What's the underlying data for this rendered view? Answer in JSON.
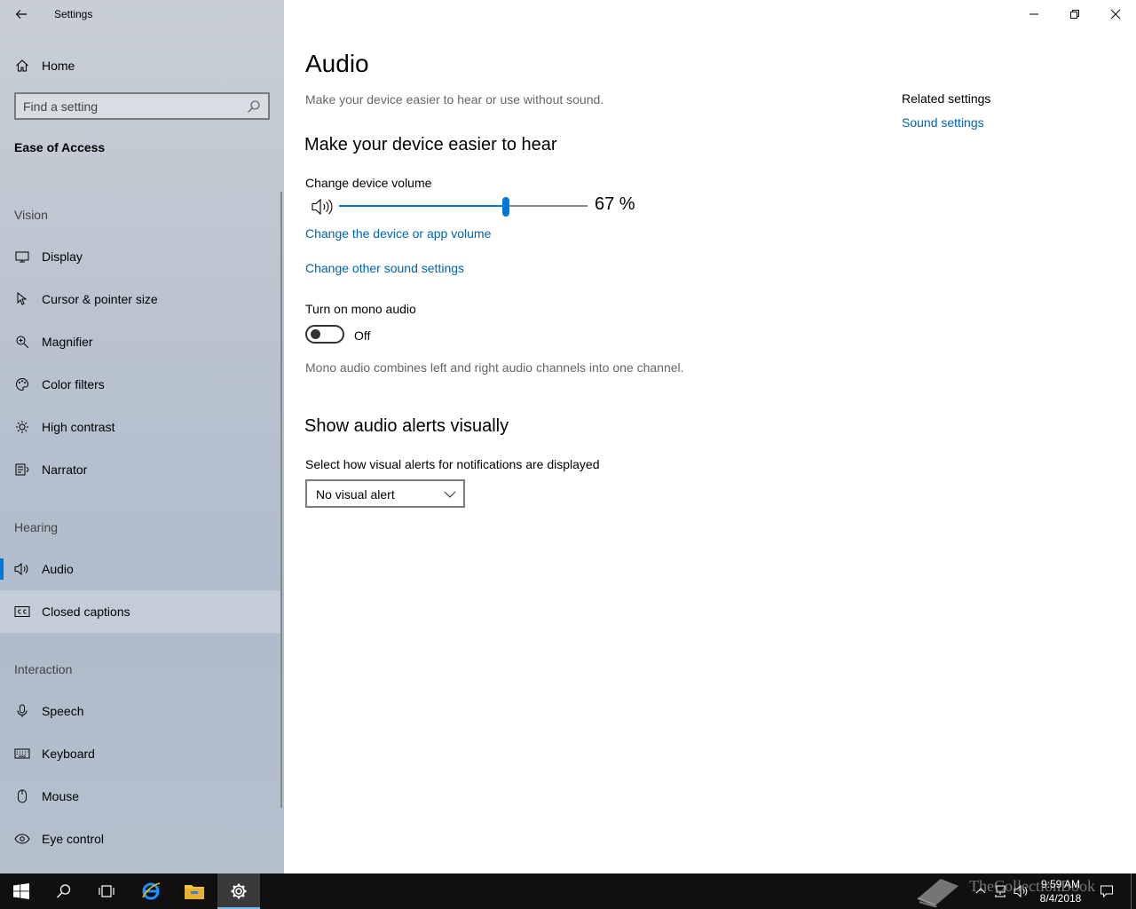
{
  "window": {
    "app_title": "Settings"
  },
  "sidebar": {
    "home_label": "Home",
    "search_placeholder": "Find a setting",
    "category": "Ease of Access",
    "groups": {
      "vision": "Vision",
      "hearing": "Hearing",
      "interaction": "Interaction"
    },
    "items": [
      {
        "label": "Display",
        "icon": "display-icon"
      },
      {
        "label": "Cursor & pointer size",
        "icon": "cursor-icon"
      },
      {
        "label": "Magnifier",
        "icon": "magnifier-icon"
      },
      {
        "label": "Color filters",
        "icon": "palette-icon"
      },
      {
        "label": "High contrast",
        "icon": "sun-icon"
      },
      {
        "label": "Narrator",
        "icon": "narrator-icon"
      },
      {
        "label": "Audio",
        "icon": "speaker-icon",
        "selected": true
      },
      {
        "label": "Closed captions",
        "icon": "cc-icon"
      },
      {
        "label": "Speech",
        "icon": "microphone-icon"
      },
      {
        "label": "Keyboard",
        "icon": "keyboard-icon"
      },
      {
        "label": "Mouse",
        "icon": "mouse-icon"
      },
      {
        "label": "Eye control",
        "icon": "eye-icon"
      }
    ]
  },
  "main": {
    "title": "Audio",
    "description": "Make your device easier to hear or use without sound.",
    "section_hear": "Make your device easier to hear",
    "volume_label": "Change device volume",
    "volume_percent": 67,
    "volume_text": "67 %",
    "link_app_volume": "Change the device or app volume",
    "link_other_sound": "Change other sound settings",
    "mono_label": "Turn on mono audio",
    "mono_state": "Off",
    "mono_help": "Mono audio combines left and right audio channels into one channel.",
    "section_alerts": "Show audio alerts visually",
    "alerts_label": "Select how visual alerts for notifications are displayed",
    "alerts_value": "No visual alert"
  },
  "related": {
    "heading": "Related settings",
    "sound_settings": "Sound settings"
  },
  "taskbar": {
    "time": "9:59 AM",
    "date": "8/4/2018",
    "watermark": "TheCollectionBook"
  },
  "colors": {
    "accent": "#0078d7",
    "link": "#0063b1"
  }
}
